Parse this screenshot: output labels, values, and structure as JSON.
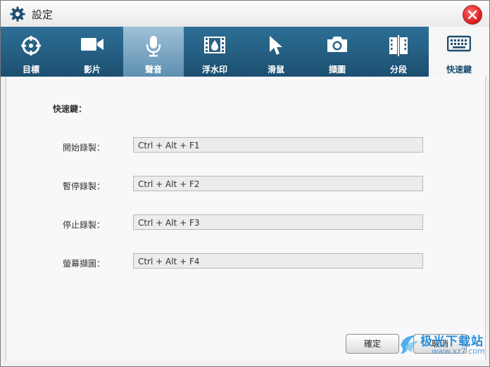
{
  "window": {
    "title": "設定"
  },
  "tabs": [
    {
      "label": "目標",
      "icon": "target-icon"
    },
    {
      "label": "影片",
      "icon": "video-camera-icon"
    },
    {
      "label": "聲音",
      "icon": "microphone-icon"
    },
    {
      "label": "浮水印",
      "icon": "watermark-film-icon"
    },
    {
      "label": "滑鼠",
      "icon": "mouse-cursor-icon"
    },
    {
      "label": "擷圖",
      "icon": "camera-icon"
    },
    {
      "label": "分段",
      "icon": "segment-icon"
    },
    {
      "label": "快速鍵",
      "icon": "keyboard-icon"
    }
  ],
  "hotkeys": {
    "section_title": "快速鍵：",
    "rows": [
      {
        "label": "開始錄製：",
        "value": "Ctrl + Alt + F1"
      },
      {
        "label": "暫停錄製：",
        "value": "Ctrl + Alt + F2"
      },
      {
        "label": "停止錄製：",
        "value": "Ctrl + Alt + F3"
      },
      {
        "label": "螢幕擷圖：",
        "value": "Ctrl + Alt + F4"
      }
    ]
  },
  "footer": {
    "ok_label": "確定",
    "cancel_label": "取消"
  },
  "watermark": {
    "text": "极光下载站",
    "url": "www.xz7.com"
  },
  "colors": {
    "tabbar": "#1f5577",
    "selected_tab": "#7fa9c6",
    "close": "#d81818"
  }
}
